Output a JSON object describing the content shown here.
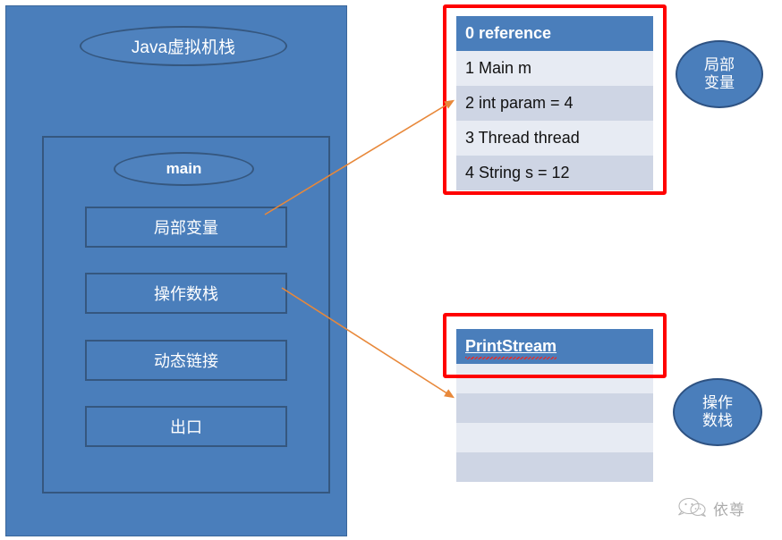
{
  "diagram": {
    "jvm_panel": {
      "title": "Java虚拟机栈",
      "frame_label": "main",
      "slots": [
        {
          "id": "local-vars",
          "label": "局部变量"
        },
        {
          "id": "operand-stack",
          "label": "操作数栈"
        },
        {
          "id": "dynamic-link",
          "label": "动态链接"
        },
        {
          "id": "exit",
          "label": "出口"
        }
      ]
    },
    "locals_table": {
      "header": "0 reference",
      "rows": [
        "1 Main m",
        "2 int param = 4",
        "3 Thread thread",
        "4 String s = 12"
      ]
    },
    "printstream_table": {
      "header": "PrintStream",
      "rows": [
        "",
        "",
        "",
        ""
      ]
    },
    "callouts": {
      "local_vars": {
        "line1": "局部",
        "line2": "变量"
      },
      "operand_stack": {
        "line1": "操作",
        "line2": "数栈"
      }
    },
    "watermark": {
      "text": "依尊",
      "icon": "wechat-logo-icon"
    },
    "colors": {
      "panel_blue": "#4A7EBB",
      "border_blue": "#35577F",
      "highlight_red": "#FF0000",
      "arrow_orange": "#E8883A",
      "row_light": "#E7EBF3",
      "row_dark": "#CED5E4"
    }
  }
}
